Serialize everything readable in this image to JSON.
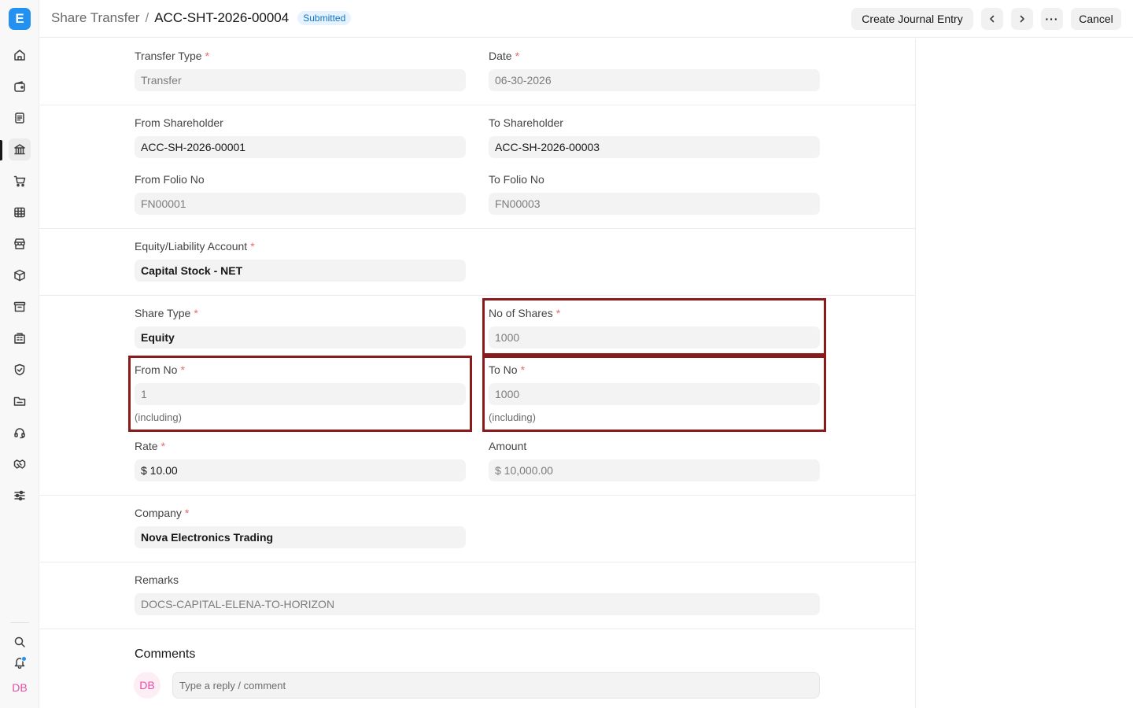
{
  "sidebar": {
    "logo": "E",
    "user_initials": "DB",
    "icons": [
      "home-icon",
      "wallet-icon",
      "document-icon",
      "bank-icon",
      "cart-icon",
      "table-icon",
      "store-icon",
      "package-icon",
      "archive-icon",
      "building-icon",
      "shield-icon",
      "folder-icon",
      "headset-icon",
      "handshake-icon",
      "sliders-icon",
      "search-icon",
      "bell-icon"
    ]
  },
  "header": {
    "parent": "Share Transfer",
    "separator": "/",
    "title": "ACC-SHT-2026-00004",
    "status": "Submitted",
    "create_journal_entry": "Create Journal Entry",
    "more": "···",
    "cancel": "Cancel"
  },
  "form": {
    "transfer_type": {
      "label": "Transfer Type",
      "value": "Transfer"
    },
    "date": {
      "label": "Date",
      "value": "06-30-2026"
    },
    "from_shareholder": {
      "label": "From Shareholder",
      "value": "ACC-SH-2026-00001"
    },
    "to_shareholder": {
      "label": "To Shareholder",
      "value": "ACC-SH-2026-00003"
    },
    "from_folio_no": {
      "label": "From Folio No",
      "value": "FN00001"
    },
    "to_folio_no": {
      "label": "To Folio No",
      "value": "FN00003"
    },
    "equity_account": {
      "label": "Equity/Liability Account",
      "value": "Capital Stock - NET"
    },
    "share_type": {
      "label": "Share Type",
      "value": "Equity"
    },
    "no_of_shares": {
      "label": "No of Shares",
      "value": "1000"
    },
    "from_no": {
      "label": "From No",
      "value": "1",
      "help": "(including)"
    },
    "to_no": {
      "label": "To No",
      "value": "1000",
      "help": "(including)"
    },
    "rate": {
      "label": "Rate",
      "value": "$ 10.00"
    },
    "amount": {
      "label": "Amount",
      "value": "$ 10,000.00"
    },
    "company": {
      "label": "Company",
      "value": "Nova Electronics Trading"
    },
    "remarks": {
      "label": "Remarks",
      "value": "DOCS-CAPITAL-ELENA-TO-HORIZON"
    },
    "required_mark": "*"
  },
  "comments": {
    "title": "Comments",
    "avatar": "DB",
    "placeholder": "Type a reply / comment"
  }
}
